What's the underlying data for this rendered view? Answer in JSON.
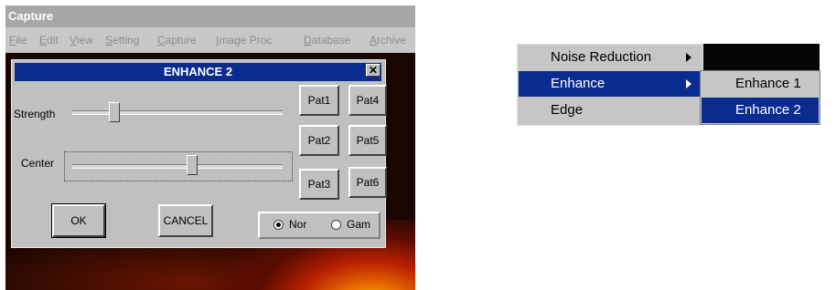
{
  "capture_window": {
    "title": "Capture",
    "menu": [
      "File",
      "Edit",
      "View",
      "Setting",
      "Capture",
      "Image Proc",
      "Database",
      "Archive"
    ],
    "menu_mnemonics": [
      "F",
      "E",
      "V",
      "S",
      "C",
      "I",
      "D",
      "A"
    ]
  },
  "dialog": {
    "title": "ENHANCE 2",
    "close_glyph": "✕",
    "strength_label": "Strength",
    "center_label": "Center",
    "strength_level": 0.2,
    "center_level": 0.57,
    "pattern_buttons": [
      "Pat1",
      "Pat4",
      "Pat2",
      "Pat5",
      "Pat3",
      "Pat6"
    ],
    "ok_label": "OK",
    "cancel_label": "CANCEL",
    "radio_options": [
      "Nor",
      "Gam"
    ],
    "selected_radio": "Nor"
  },
  "popup_menu": {
    "items": [
      "Noise Reduction",
      "Enhance",
      "Edge"
    ],
    "highlighted": "Enhance"
  },
  "submenu": {
    "items": [
      "Enhance 1",
      "Enhance 2"
    ],
    "highlighted": "Enhance 2"
  },
  "colors": {
    "title_bar_active": "#0a2b8f",
    "title_bar_inactive": "#a7a7a7",
    "face": "#c0c0c0",
    "highlight": "#0a2b8f"
  }
}
